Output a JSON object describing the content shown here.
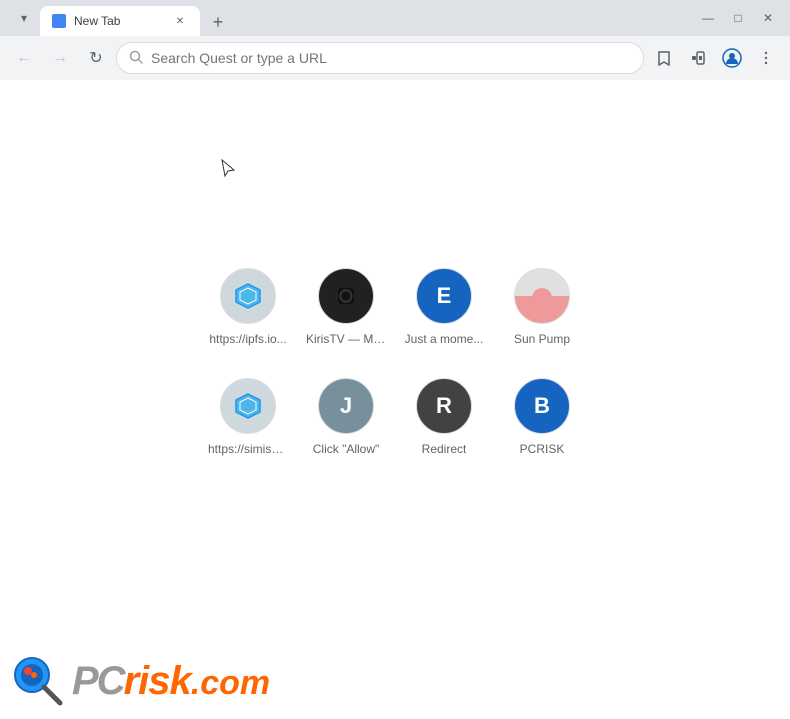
{
  "browser": {
    "tab": {
      "label": "New Tab",
      "favicon": "🔵"
    },
    "new_tab_icon": "+",
    "window_controls": [
      "—",
      "□",
      "✕"
    ]
  },
  "toolbar": {
    "back_title": "Back",
    "forward_title": "Forward",
    "refresh_title": "Refresh",
    "address_placeholder": "Search Quest or type a URL",
    "address_value": "",
    "bookmark_title": "Bookmark",
    "extensions_title": "Extensions",
    "profile_title": "Profile",
    "menu_title": "Menu"
  },
  "shortcuts": {
    "row1": [
      {
        "id": "ipfs",
        "label": "https://ipfs.io...",
        "icon_text": "🔷",
        "icon_bg": "#b0bec5",
        "icon_type": "image"
      },
      {
        "id": "kiristv",
        "label": "KirisTV — Mo...",
        "icon_text": "⬛",
        "icon_bg": "#212121",
        "icon_type": "dark"
      },
      {
        "id": "just-a-moment",
        "label": "Just a mome...",
        "icon_text": "E",
        "icon_bg": "#1565c0",
        "icon_type": "letter"
      },
      {
        "id": "sun-pump",
        "label": "Sun Pump",
        "icon_text": "☀",
        "icon_bg": "#ef9a9a",
        "icon_type": "image"
      }
    ],
    "row2": [
      {
        "id": "simise",
        "label": "https://simise...",
        "icon_text": "🔷",
        "icon_bg": "#b0bec5",
        "icon_type": "image"
      },
      {
        "id": "click-allow",
        "label": "Click \"Allow\"",
        "icon_text": "J",
        "icon_bg": "#78909c",
        "icon_type": "letter"
      },
      {
        "id": "redirect",
        "label": "Redirect",
        "icon_text": "R",
        "icon_bg": "#424242",
        "icon_type": "letter"
      },
      {
        "id": "pcrisk",
        "label": "PCRISK",
        "icon_text": "B",
        "icon_bg": "#1565c0",
        "icon_type": "letter"
      }
    ]
  },
  "watermark": {
    "brand": "PC",
    "risk": "risk",
    "dotcom": ".com"
  }
}
